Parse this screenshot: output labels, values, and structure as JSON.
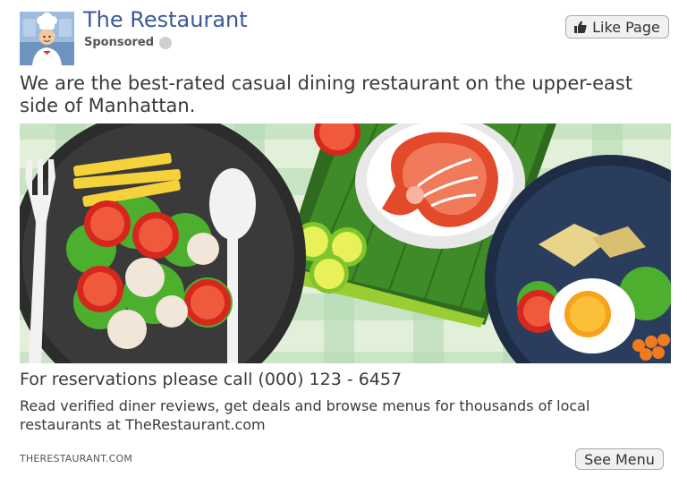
{
  "ad": {
    "page_name": "The Restaurant",
    "sponsored_label": "Sponsored",
    "like_button_label": "Like Page",
    "description": "We are the best-rated casual dining restaurant on the upper-east side of Manhattan.",
    "headline": "For reservations please call (000) 123 - 6457",
    "link_description": "Read verified diner reviews, get deals and browse menus for thousands of local restaurants at TheRestaurant.com",
    "display_url": "THERESTAURANT.COM",
    "cta_label": "See Menu"
  },
  "colors": {
    "title": "#3b5998",
    "button_bg": "#f1f1f1",
    "tablecloth": "#cfe6c6"
  },
  "icons": {
    "like": "thumbs-up-icon",
    "audience": "globe-icon"
  }
}
